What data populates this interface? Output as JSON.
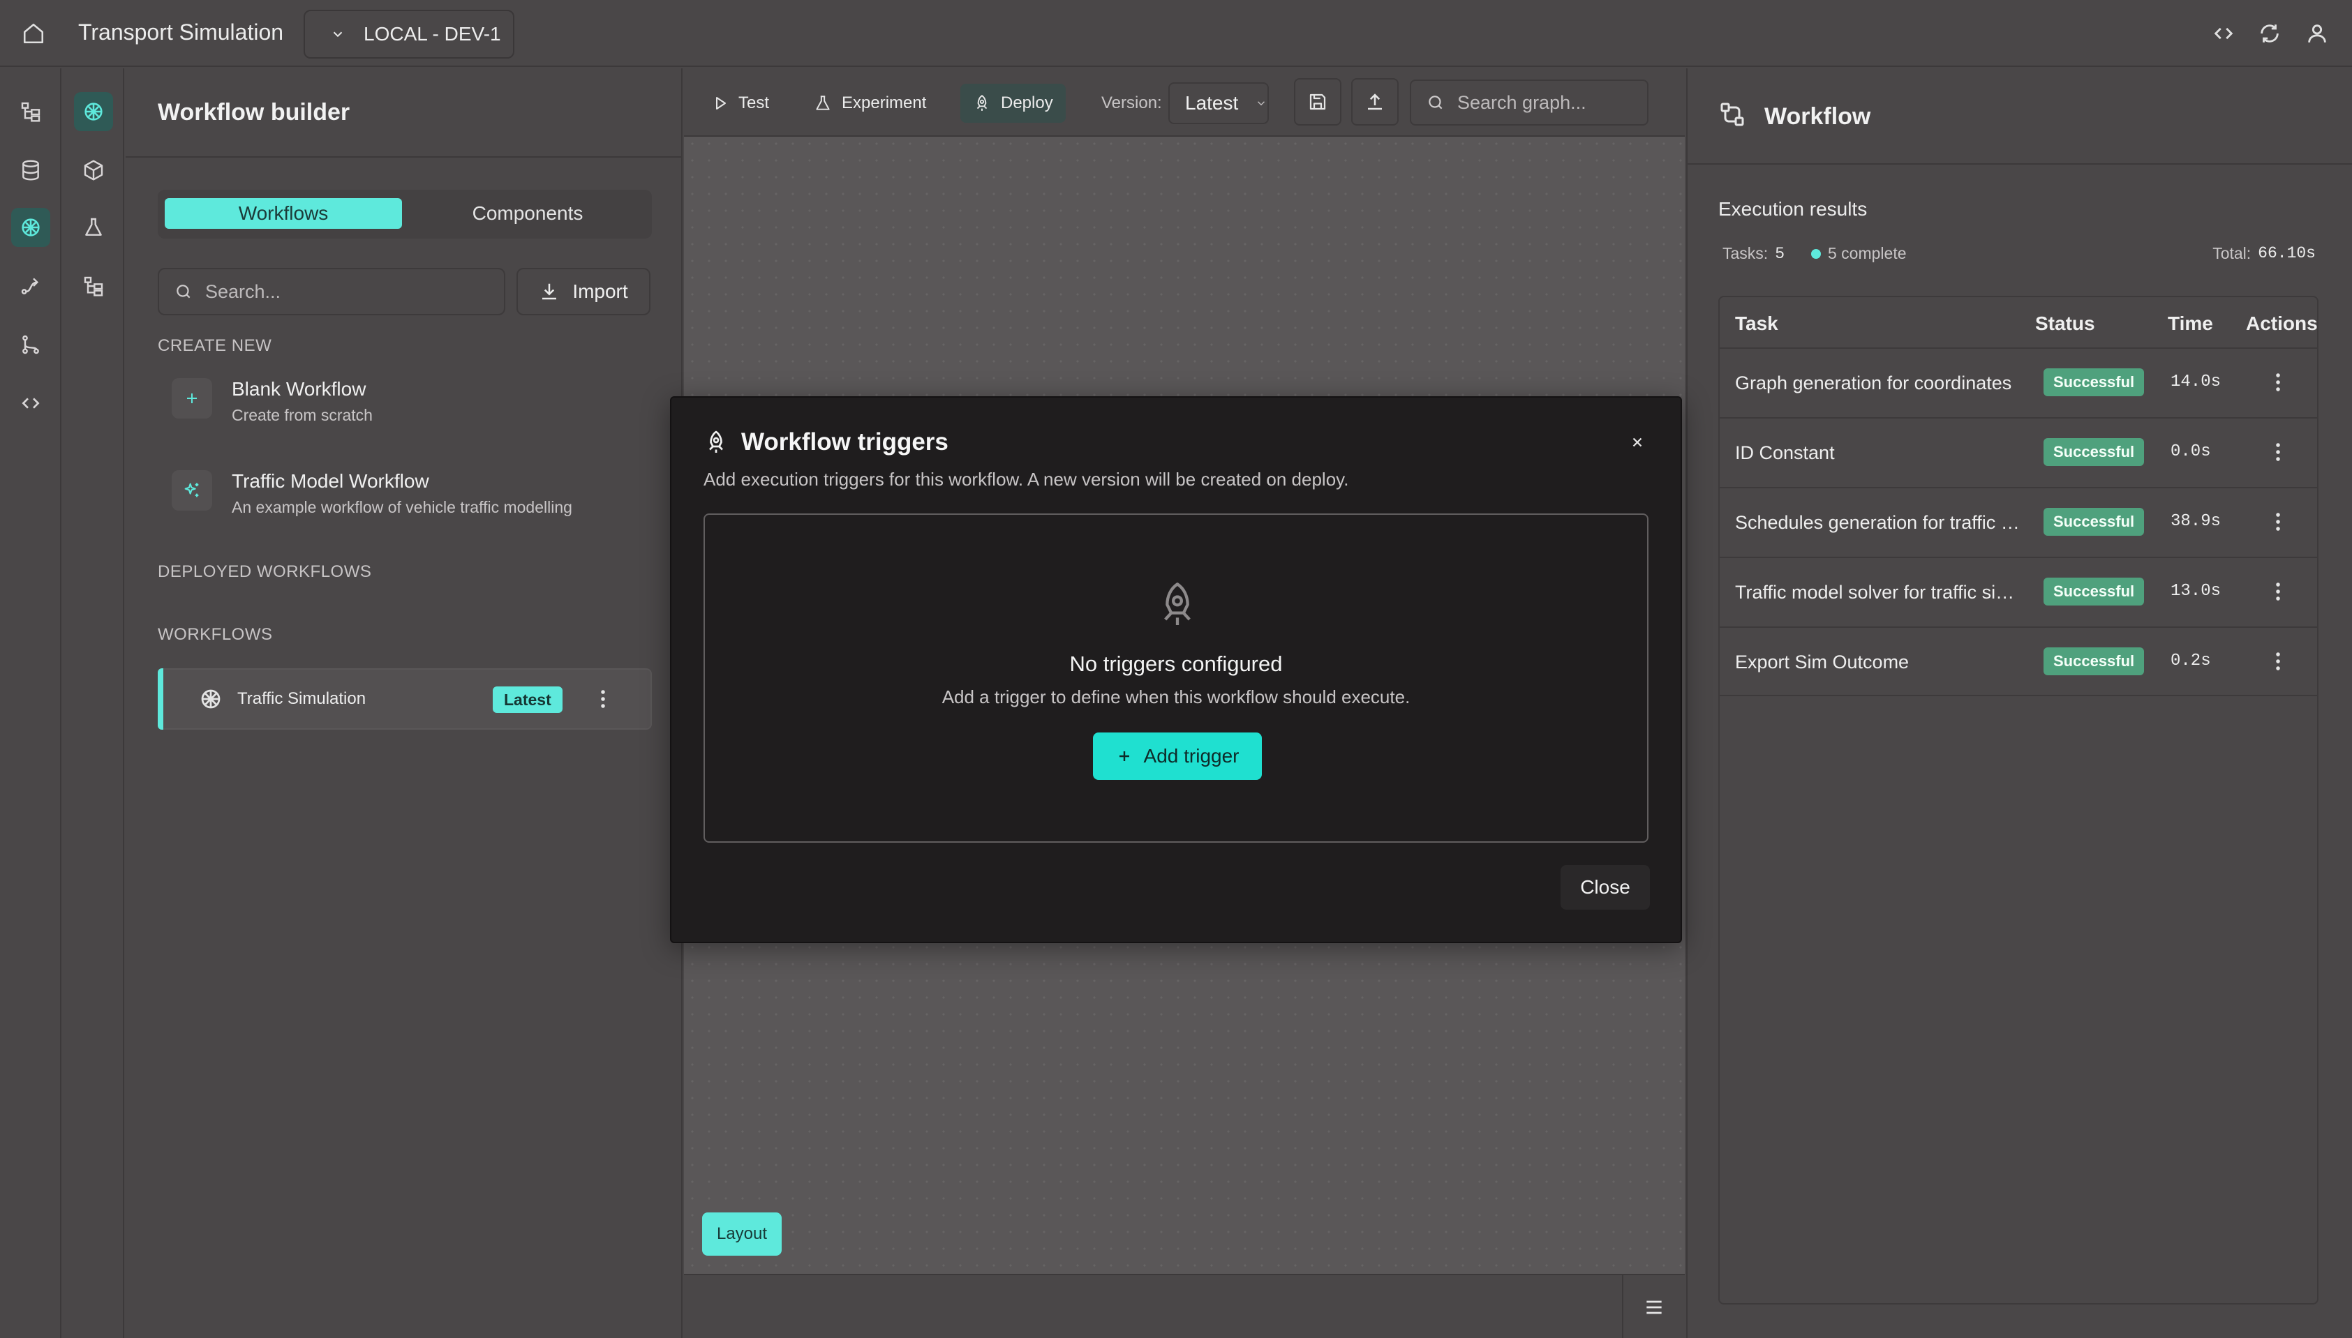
{
  "header": {
    "app_title": "Transport Simulation",
    "environment": "LOCAL - DEV-1"
  },
  "left_panel": {
    "title": "Workflow builder",
    "tabs": [
      "Workflows",
      "Components"
    ],
    "search_placeholder": "Search...",
    "import_label": "Import",
    "create_new_label": "CREATE NEW",
    "templates": [
      {
        "name": "Blank Workflow",
        "description": "Create from scratch",
        "icon": "plus-icon"
      },
      {
        "name": "Traffic Model Workflow",
        "description": "An example workflow of vehicle traffic modelling",
        "icon": "sparkles-icon"
      }
    ],
    "deployed_label": "DEPLOYED WORKFLOWS",
    "workflows_label": "WORKFLOWS",
    "workflows": [
      {
        "name": "Traffic Simulation",
        "badge": "Latest",
        "icon": "brain-icon"
      }
    ]
  },
  "toolbar": {
    "test": "Test",
    "experiment": "Experiment",
    "deploy": "Deploy",
    "version_label": "Version:",
    "version_value": "Latest",
    "search_placeholder": "Search graph..."
  },
  "canvas": {
    "layout_button": "Layout"
  },
  "right_panel": {
    "title": "Workflow",
    "execution_title": "Execution results",
    "tasks_label": "Tasks:",
    "tasks_count": "5",
    "complete_text": "5 complete",
    "total_label": "Total:",
    "total_value": "66.10s",
    "columns": [
      "Task",
      "Status",
      "Time",
      "Actions"
    ],
    "rows": [
      {
        "task": "Graph generation for coordinates",
        "status": "Successful",
        "time": "14.0s"
      },
      {
        "task": "ID Constant",
        "status": "Successful",
        "time": "0.0s"
      },
      {
        "task": "Schedules generation for traffic simulation",
        "status": "Successful",
        "time": "38.9s"
      },
      {
        "task": "Traffic model solver for traffic simulation",
        "status": "Successful",
        "time": "13.0s"
      },
      {
        "task": "Export Sim Outcome",
        "status": "Successful",
        "time": "0.2s"
      }
    ]
  },
  "modal": {
    "title": "Workflow triggers",
    "description": "Add execution triggers for this workflow. A new version will be created on deploy.",
    "empty_title": "No triggers configured",
    "empty_description": "Add a trigger to define when this workflow should execute.",
    "add_trigger": "Add trigger",
    "close": "Close"
  },
  "colors": {
    "accent": "#5ee9dc",
    "success": "#4fa17d",
    "modal_bg": "#1f1d1e",
    "panel_bg": "#4a4748"
  }
}
